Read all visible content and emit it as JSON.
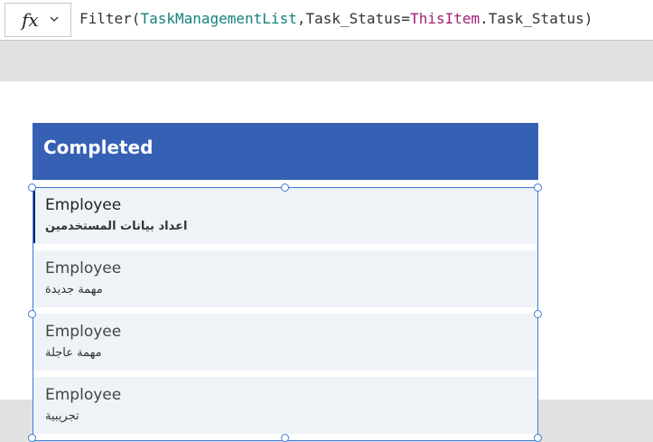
{
  "formula_bar": {
    "fx_label": "fx",
    "formula_tokens": {
      "t1": "Filter(",
      "t2": "TaskManagementList",
      "t3": ",Task_Status=",
      "t4": "ThisItem",
      "t5": ".Task_Status)"
    }
  },
  "gallery": {
    "header_title": "Completed",
    "rows": [
      {
        "title": "Employee",
        "subtitle": "اعداد بيانات المستخدمين"
      },
      {
        "title": "Employee",
        "subtitle": "مهمة جديدة"
      },
      {
        "title": "Employee",
        "subtitle": "مهمة عاجلة"
      },
      {
        "title": "Employee",
        "subtitle": "تجريبية"
      }
    ]
  },
  "colors": {
    "header_bg": "#3660b4",
    "row_bg": "#eff3f8",
    "selection": "#3a7bd5",
    "formula_identifier": "#14807c",
    "formula_keyword": "#a31e77"
  }
}
